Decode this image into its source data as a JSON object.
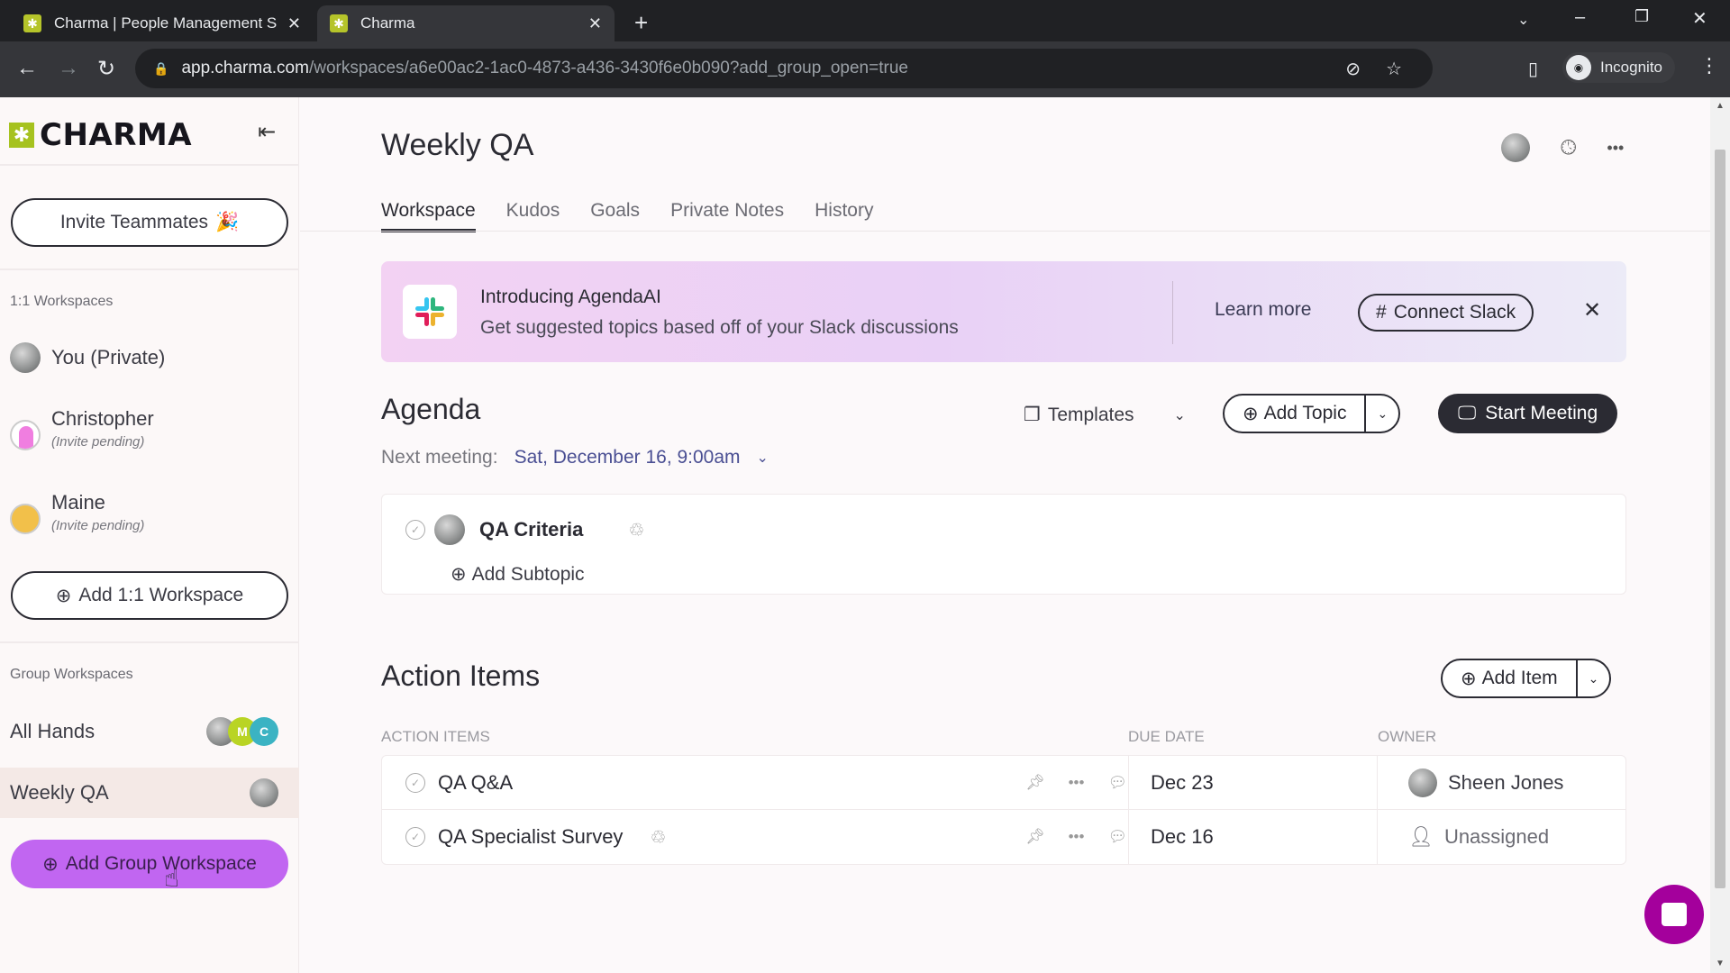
{
  "browser": {
    "tabs": [
      {
        "title": "Charma | People Management S",
        "active": false
      },
      {
        "title": "Charma",
        "active": true
      }
    ],
    "url_host": "app.charma.com",
    "url_path": "/workspaces/a6e00ac2-1ac0-4873-a436-3430f6e0b090?add_group_open=true",
    "profile_label": "Incognito"
  },
  "sidebar": {
    "logo_text": "CHARMA",
    "invite_label": "Invite Teammates",
    "invite_emoji": "🎉",
    "one_on_one_label": "1:1 Workspaces",
    "one_on_one": [
      {
        "name": "You (Private)",
        "sub": ""
      },
      {
        "name": "Christopher",
        "sub": "(Invite pending)"
      },
      {
        "name": "Maine",
        "sub": "(Invite pending)"
      }
    ],
    "add_one_on_one_label": "Add 1:1 Workspace",
    "group_label": "Group Workspaces",
    "groups": [
      {
        "name": "All Hands",
        "avatars": [
          "photo",
          "M",
          "C"
        ]
      },
      {
        "name": "Weekly QA",
        "avatars": [
          "photo"
        ],
        "active": true
      }
    ],
    "add_group_label": "Add Group Workspace"
  },
  "header": {
    "title": "Weekly QA",
    "tabs": [
      "Workspace",
      "Kudos",
      "Goals",
      "Private Notes",
      "History"
    ],
    "active_tab": "Workspace"
  },
  "banner": {
    "title": "Introducing AgendaAI",
    "subtitle": "Get suggested topics based off of your Slack discussions",
    "learn_more": "Learn more",
    "connect_label": "Connect Slack"
  },
  "agenda": {
    "title": "Agenda",
    "templates_label": "Templates",
    "add_topic_label": "Add Topic",
    "start_meeting_label": "Start Meeting",
    "next_meeting_label": "Next meeting:",
    "next_meeting_value": "Sat, December 16, 9:00am",
    "topics": [
      {
        "name": "QA Criteria",
        "recurring": true
      }
    ],
    "add_subtopic_label": "Add Subtopic"
  },
  "action_items": {
    "title": "Action Items",
    "add_item_label": "Add Item",
    "columns": [
      "Action Items",
      "Due Date",
      "Owner"
    ],
    "rows": [
      {
        "name": "QA Q&A",
        "recurring": false,
        "due": "Dec 23",
        "owner": "Sheen Jones",
        "assigned": true
      },
      {
        "name": "QA Specialist Survey",
        "recurring": true,
        "due": "Dec 16",
        "owner": "Unassigned",
        "assigned": false
      }
    ]
  },
  "colors": {
    "brand_green": "#a6c21f",
    "accent_purple": "#c166f1",
    "link_blue": "#4a4f93",
    "dark": "#2b2b33",
    "chat_magenta": "#a4009c"
  }
}
